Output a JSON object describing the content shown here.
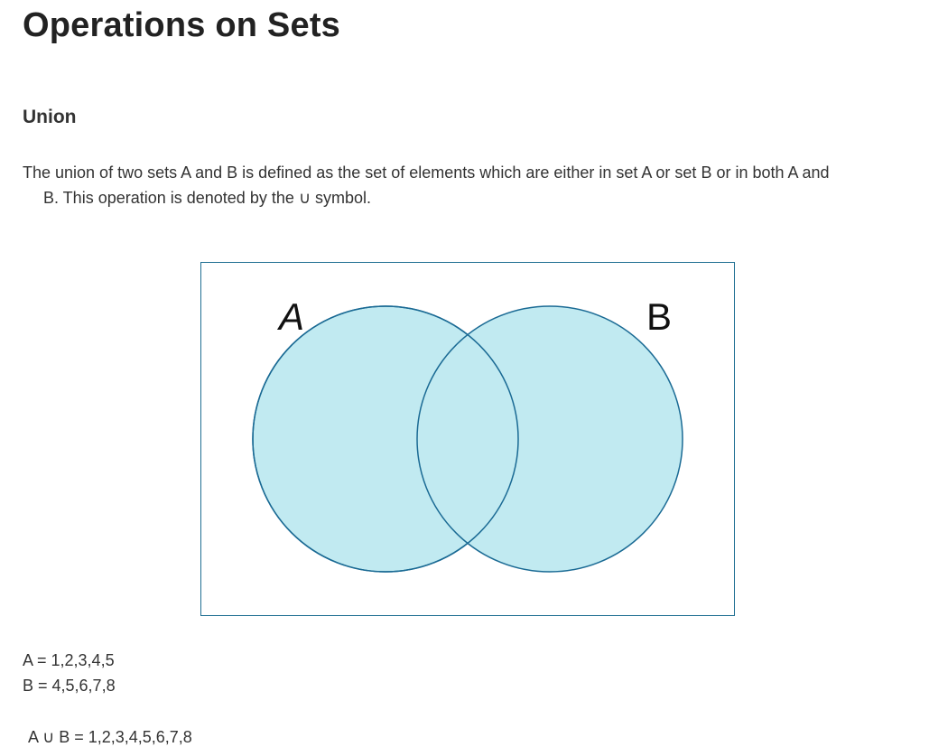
{
  "title": "Operations on Sets",
  "section": {
    "heading": "Union",
    "description_line1": "The union of two sets A and B is defined as the set of elements which are either in set A or set B or in both A and",
    "description_line2": "B. This operation is denoted by the ∪ symbol."
  },
  "venn": {
    "label_a": "A",
    "label_b": "B",
    "fill_color": "#c1eaf1",
    "stroke_color": "#1a6a94"
  },
  "sets": {
    "a": "A = 1,2,3,4,5",
    "b": "B = 4,5,6,7,8",
    "union": "A ∪ B = 1,2,3,4,5,6,7,8"
  }
}
